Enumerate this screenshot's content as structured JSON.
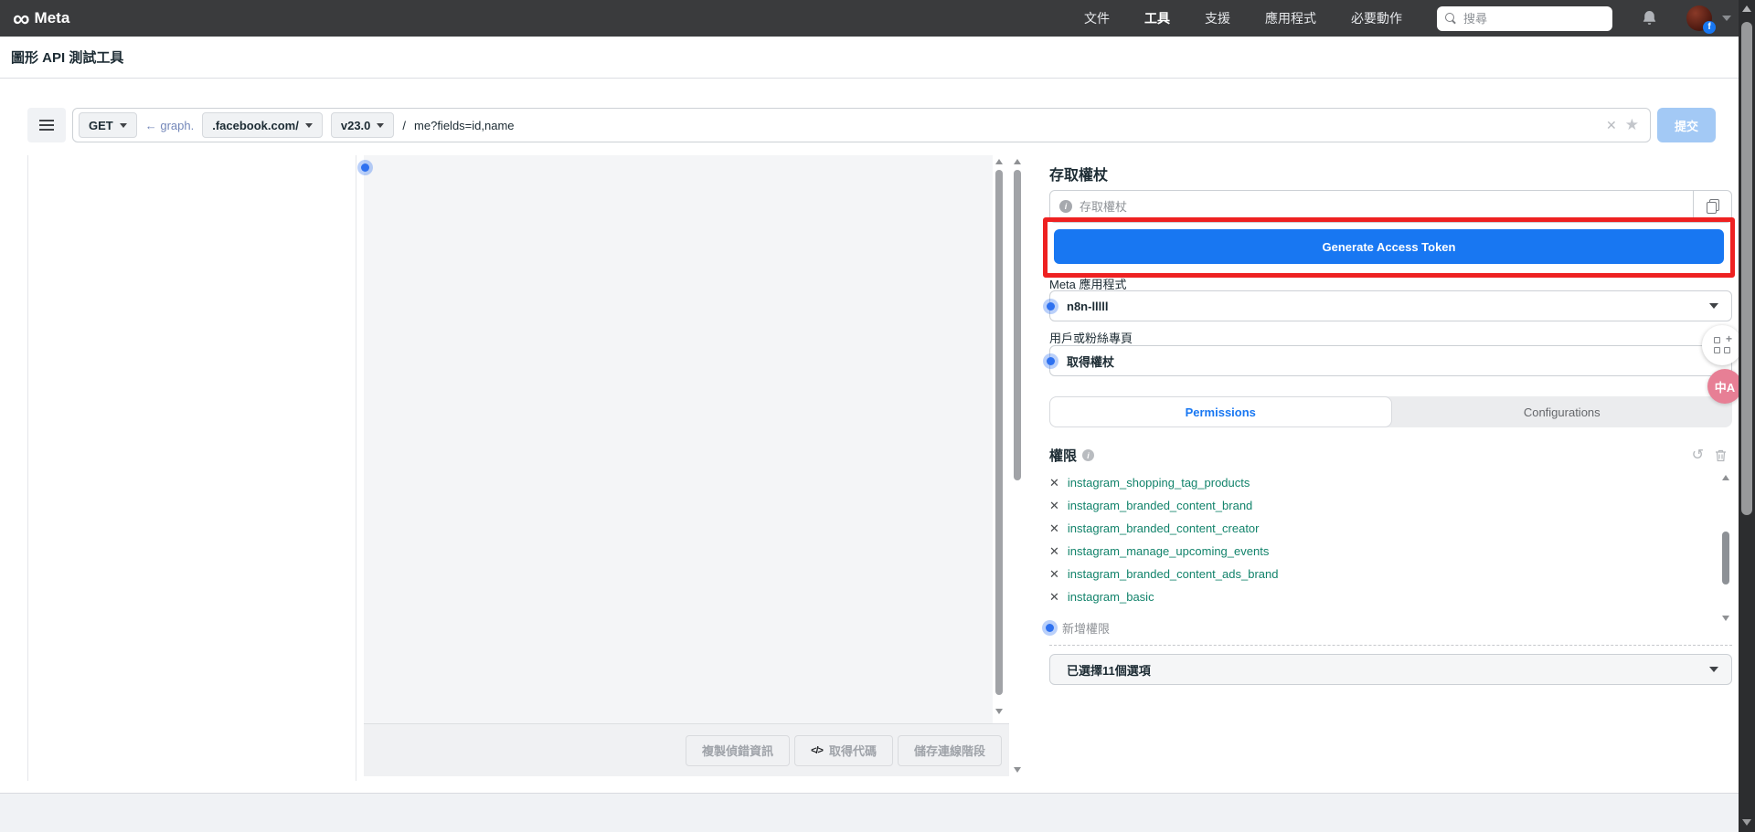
{
  "colors": {
    "accent_blue": "#1877f2",
    "annotation_red": "#ee2121",
    "permission_green": "#12836b",
    "navbar_bg": "#3a3b3d",
    "submit_disabled_blue": "#a3c9f5"
  },
  "icons": {
    "meta_infinity": "∞",
    "facebook_f": "f",
    "clear": "✕",
    "star": "★",
    "undo": "↺",
    "code": "</>",
    "info": "i",
    "remove": "✕",
    "plus": "+",
    "translate": "中A"
  },
  "navbar": {
    "brand": "Meta",
    "items": [
      {
        "label": "文件"
      },
      {
        "label": "工具"
      },
      {
        "label": "支援"
      },
      {
        "label": "應用程式"
      },
      {
        "label": "必要動作"
      }
    ],
    "search_placeholder": "搜尋"
  },
  "page": {
    "title": "圖形 API 測試工具"
  },
  "request_bar": {
    "method": "GET",
    "host_link": "← graph.",
    "host_suffix": ".facebook.com/",
    "version": "v23.0",
    "path_separator": "/",
    "path": "me?fields=id,name",
    "submit_label": "提交"
  },
  "access_token": {
    "heading": "存取權杖",
    "placeholder": "存取權杖",
    "generate_button_label": "Generate Access Token"
  },
  "app_select": {
    "label": "Meta 應用程式",
    "value": "n8n-lllll"
  },
  "user_select": {
    "label": "用戶或粉絲專頁",
    "value": "取得權杖"
  },
  "tabs": {
    "permissions": "Permissions",
    "configurations": "Configurations"
  },
  "permissions": {
    "heading": "權限",
    "items": [
      "instagram_shopping_tag_products",
      "instagram_branded_content_brand",
      "instagram_branded_content_creator",
      "instagram_manage_upcoming_events",
      "instagram_branded_content_ads_brand",
      "instagram_basic"
    ],
    "add_permission_label": "新增權限",
    "selected_summary": "已選擇11個選項"
  },
  "response_footer": {
    "copy_debug_label": "複製偵錯資訊",
    "get_code_label": "取得代碼",
    "save_session_label": "儲存連線階段"
  }
}
